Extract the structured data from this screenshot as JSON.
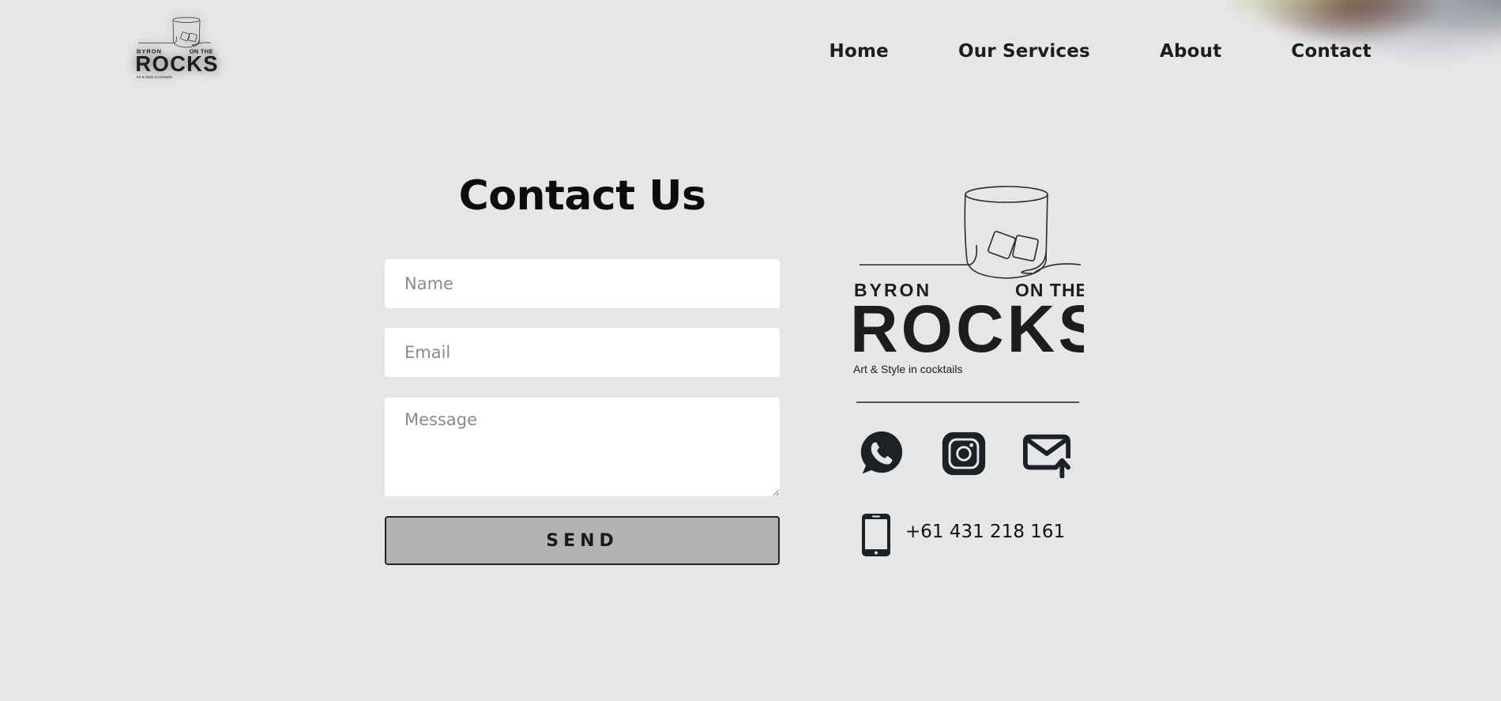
{
  "nav": {
    "items": [
      {
        "label": "Home"
      },
      {
        "label": "Our Services"
      },
      {
        "label": "About"
      },
      {
        "label": "Contact"
      }
    ]
  },
  "logo": {
    "line1_left": "BYRON",
    "line1_right": "ON THE",
    "word": "ROCKS",
    "tagline": "Art & Style in cocktails"
  },
  "form": {
    "title": "Contact Us",
    "name_placeholder": "Name",
    "email_placeholder": "Email",
    "message_placeholder": "Message",
    "send_label": "SEND"
  },
  "contact": {
    "phone": "+61 431 218 161"
  },
  "icons": {
    "social": [
      "whatsapp-icon",
      "instagram-icon",
      "mail-icon"
    ],
    "phone": "mobile-phone-icon"
  },
  "colors": {
    "background": "#e6e6e8",
    "text": "#1c1c1c",
    "button": "#b1b2b2",
    "field": "#ffffff"
  }
}
